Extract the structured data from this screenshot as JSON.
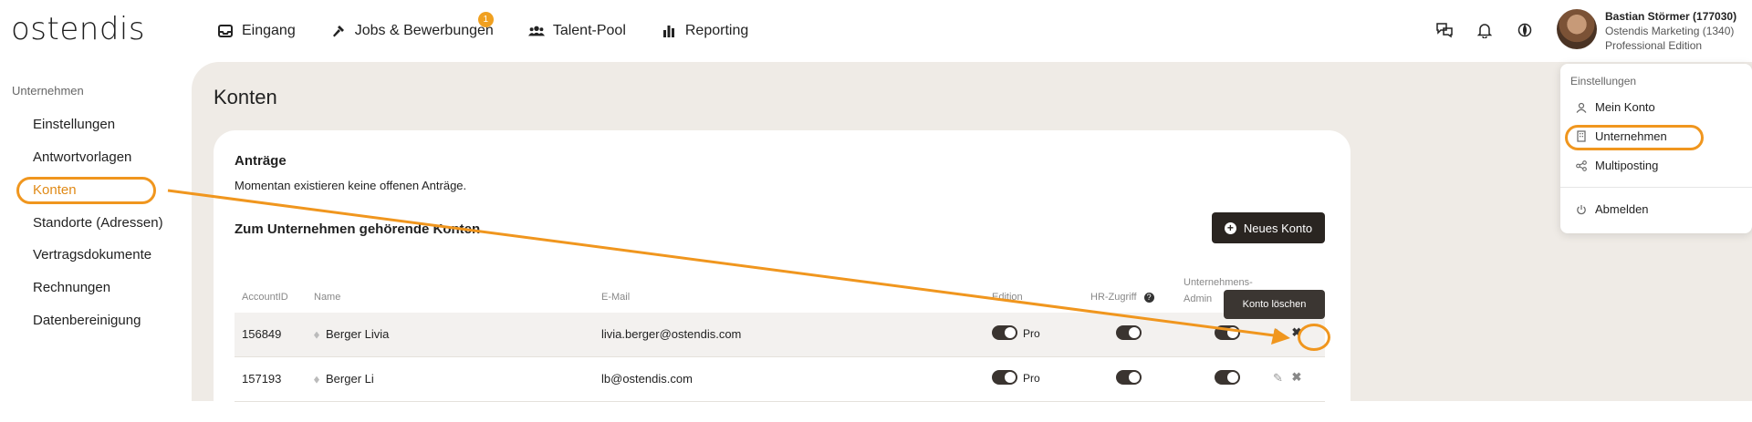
{
  "app": {
    "logo": "ostendis"
  },
  "nav": {
    "inbox": "Eingang",
    "jobs": "Jobs & Bewerbungen",
    "jobs_badge": "1",
    "talent": "Talent-Pool",
    "reporting": "Reporting"
  },
  "user": {
    "name": "Bastian Störmer (177030)",
    "company": "Ostendis Marketing (1340)",
    "edition": "Professional Edition"
  },
  "sidebar": {
    "heading": "Unternehmen",
    "items": [
      {
        "label": "Einstellungen"
      },
      {
        "label": "Antwortvorlagen"
      },
      {
        "label": "Konten"
      },
      {
        "label": "Standorte (Adressen)"
      },
      {
        "label": "Vertragsdokumente"
      },
      {
        "label": "Rechnungen"
      },
      {
        "label": "Datenbereinigung"
      }
    ]
  },
  "page": {
    "title": "Konten",
    "requests_title": "Anträge",
    "requests_text": "Momentan existieren keine offenen Anträge.",
    "accounts_title": "Zum Unternehmen gehörende Konten",
    "new_account_button": "Neues Konto"
  },
  "table": {
    "headers": {
      "account_id": "AccountID",
      "name": "Name",
      "email": "E-Mail",
      "edition": "Edition",
      "hr_access": "HR-Zugriff",
      "company_admin_line1": "Unternehmens-",
      "company_admin_line2": "Admin"
    },
    "rows": [
      {
        "id": "156849",
        "name": "Berger Livia",
        "email": "livia.berger@ostendis.com",
        "edition": "Pro"
      },
      {
        "id": "157193",
        "name": "Berger Li",
        "email": "lb@ostendis.com",
        "edition": "Pro"
      }
    ]
  },
  "tooltip": {
    "delete": "Konto löschen"
  },
  "dropdown": {
    "heading": "Einstellungen",
    "items": {
      "account": "Mein Konto",
      "company": "Unternehmen",
      "multiposting": "Multiposting",
      "logout": "Abmelden"
    }
  },
  "colors": {
    "accent": "#f0961e",
    "brand_dark": "#2a2521",
    "background": "#efebe6"
  }
}
